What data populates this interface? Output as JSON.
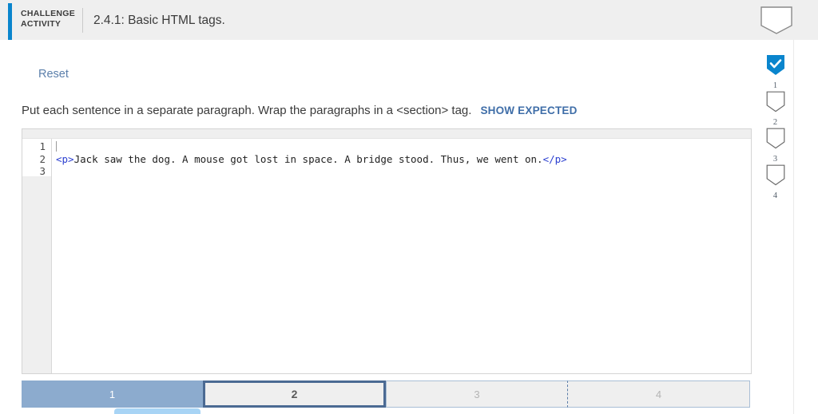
{
  "header": {
    "kicker": "CHALLENGE ACTIVITY",
    "title": "2.4.1: Basic HTML tags.",
    "bookmark_icon": "pennant-outline-icon",
    "accent_color": "#0a85cd"
  },
  "activity": {
    "reset_label": "Reset",
    "prompt": "Put each sentence in a separate paragraph. Wrap the paragraphs in a <section> tag.",
    "show_expected_label": "SHOW EXPECTED",
    "show_expected_color": "#3f6ea8"
  },
  "editor": {
    "line_numbers": [
      "1",
      "2",
      "3"
    ],
    "lines": [
      {
        "number": "1",
        "open_tag": "",
        "text": "",
        "close_tag": ""
      },
      {
        "number": "2",
        "open_tag": "<p>",
        "text": "Jack saw the dog. A mouse got lost in space. A bridge stood. Thus, we went on.",
        "close_tag": "</p>"
      },
      {
        "number": "3",
        "open_tag": "",
        "text": "",
        "close_tag": ""
      }
    ],
    "tag_color": "#2b3fd0",
    "cursor_line": "1"
  },
  "tabs": [
    {
      "label": "1",
      "state": "completed"
    },
    {
      "label": "2",
      "state": "selected"
    },
    {
      "label": "3",
      "state": "locked"
    },
    {
      "label": "4",
      "state": "locked"
    }
  ],
  "rail": {
    "items": [
      {
        "number": "1",
        "icon": "pennant-check-icon",
        "state": "complete"
      },
      {
        "number": "2",
        "icon": "pennant-outline-icon",
        "state": "empty"
      },
      {
        "number": "3",
        "icon": "pennant-outline-icon",
        "state": "empty"
      },
      {
        "number": "4",
        "icon": "pennant-outline-icon",
        "state": "empty"
      }
    ],
    "complete_color": "#0a85cd"
  }
}
